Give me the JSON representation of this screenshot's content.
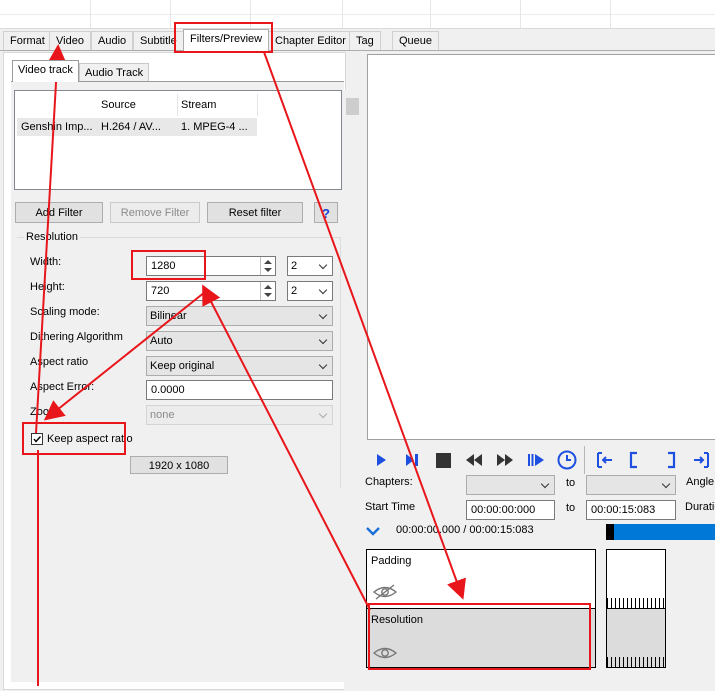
{
  "main_tabs": [
    "Format",
    "Video",
    "Audio",
    "Subtitle",
    "Filters/Preview",
    "Chapter Editor",
    "Tag",
    "Queue"
  ],
  "active_main_tab": "Filters/Preview",
  "sub_tabs": [
    "Video track",
    "Audio Track"
  ],
  "track_list": {
    "columns": [
      "Source",
      "Stream"
    ],
    "rows": [
      {
        "name": "Genshin Imp...",
        "source": "H.264 / AV...",
        "stream": "1. MPEG-4 ..."
      }
    ]
  },
  "filter_buttons": {
    "add": "Add Filter",
    "remove": "Remove Filter",
    "reset": "Reset filter",
    "help": "?"
  },
  "resolution": {
    "group_title": "Resolution",
    "width_label": "Width:",
    "width_value": "1280",
    "width_multiple": "2",
    "height_label": "Height:",
    "height_value": "720",
    "height_multiple": "2",
    "scaling_label": "Scaling mode:",
    "scaling_value": "Bilinear",
    "dither_label": "Dithering Algorithm",
    "dither_value": "Auto",
    "aspect_label": "Aspect ratio",
    "aspect_value": "Keep original",
    "aspect_error_label": "Aspect Error:",
    "aspect_error_value": "0.0000",
    "zoom_label": "Zoom:",
    "zoom_value": "none",
    "keep_aspect_label": "Keep aspect ratio",
    "keep_aspect_checked": true,
    "source_res": "1920 x 1080"
  },
  "player": {
    "chapters_label": "Chapters:",
    "to_label": "to",
    "angle_label": "Angle",
    "start_time_label": "Start Time",
    "start_time": "00:00:00:000",
    "end_time": "00:00:15:083",
    "duration_label": "Duratio",
    "position_text": "00:00:00.000 / 00:00:15:083",
    "icons": [
      "play-icon",
      "step-forward-icon",
      "stop-icon",
      "rewind-icon",
      "fast-forward-icon",
      "next-frame-icon",
      "clock-icon",
      "set-start-icon",
      "bracket-start-icon",
      "bracket-end-icon",
      "set-end-icon"
    ],
    "accent": "#1f4fe0"
  },
  "filter_stack": [
    {
      "label": "Padding"
    },
    {
      "label": "Resolution"
    }
  ],
  "annotation_color": "#e8161b"
}
